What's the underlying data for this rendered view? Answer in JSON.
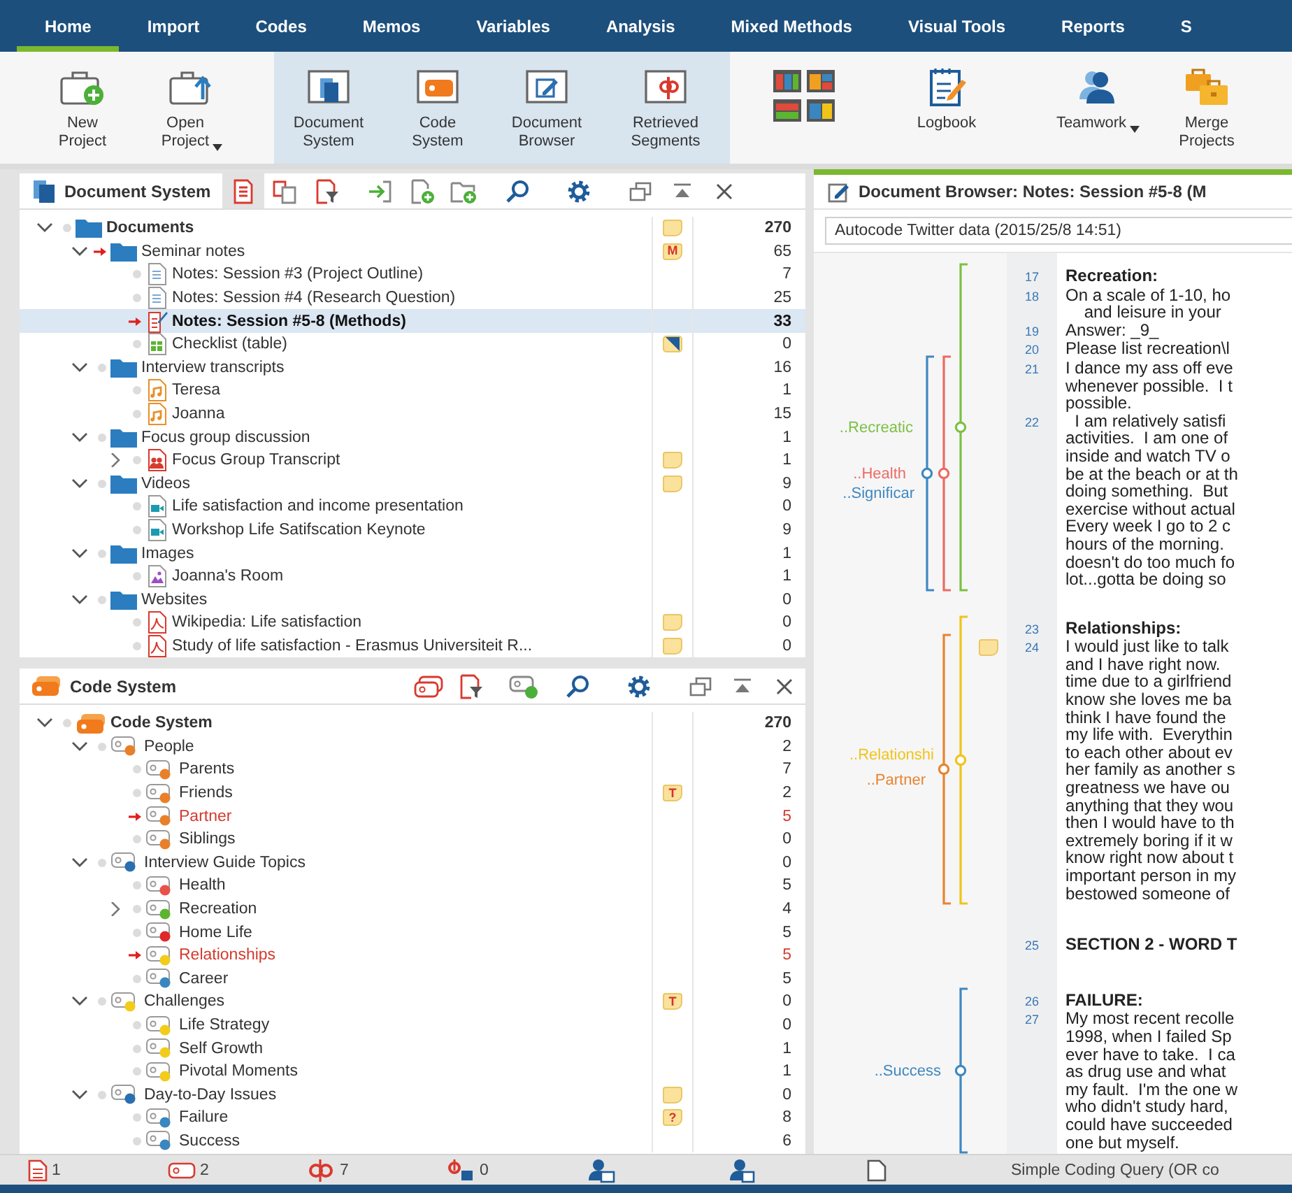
{
  "menu_tabs": [
    {
      "label": "Home",
      "selected": true
    },
    {
      "label": "Import",
      "selected": false
    },
    {
      "label": "Codes",
      "selected": false
    },
    {
      "label": "Memos",
      "selected": false
    },
    {
      "label": "Variables",
      "selected": false
    },
    {
      "label": "Analysis",
      "selected": false
    },
    {
      "label": "Mixed Methods",
      "selected": false
    },
    {
      "label": "Visual Tools",
      "selected": false
    },
    {
      "label": "Reports",
      "selected": false
    },
    {
      "label": "S",
      "selected": false
    }
  ],
  "ribbon": [
    {
      "kind": "new-project",
      "label": "New Project",
      "on": false
    },
    {
      "kind": "open-project",
      "label": "Open Project",
      "on": false,
      "dropdown": true
    },
    {
      "kind": "document-system",
      "label": "Document System",
      "on": true
    },
    {
      "kind": "code-system",
      "label": "Code System",
      "on": true
    },
    {
      "kind": "document-browser",
      "label": "Document Browser",
      "on": true
    },
    {
      "kind": "retrieved-segments",
      "label": "Retrieved Segments",
      "on": true
    },
    {
      "kind": "layouts",
      "on": false
    },
    {
      "kind": "logbook",
      "label": "Logbook",
      "on": false
    },
    {
      "kind": "teamwork",
      "label": "Teamwork",
      "on": false,
      "dropdown": true
    },
    {
      "kind": "merge-projects",
      "label": "Merge Projects",
      "on": false
    }
  ],
  "document_system": {
    "title": "Document System",
    "toolbar": [
      {
        "kind": "document-list",
        "on": true
      },
      {
        "kind": "document-pair",
        "on": false
      },
      {
        "kind": "document-filter",
        "on": false
      },
      {
        "kind": "import",
        "on": false
      },
      {
        "kind": "new-document",
        "on": false
      },
      {
        "kind": "new-folder",
        "on": false
      },
      {
        "kind": "search",
        "on": false
      },
      {
        "kind": "settings",
        "on": false
      },
      {
        "kind": "undock",
        "on": false
      },
      {
        "kind": "collapse",
        "on": false
      },
      {
        "kind": "close",
        "on": false
      }
    ],
    "items": [
      {
        "label": "Documents",
        "kind": "folder",
        "count": "270",
        "activated": false,
        "selected": false,
        "expanded": true,
        "memo": {
          "kind": "note"
        },
        "children": [
          {
            "label": "Seminar notes",
            "kind": "folder",
            "count": "65",
            "activated": true,
            "selected": false,
            "expanded": true,
            "memo": {
              "kind": "letter",
              "text": "M"
            },
            "children": [
              {
                "label": "Notes: Session #3 (Project Outline)",
                "kind": "text",
                "count": "7",
                "activated": false,
                "selected": false
              },
              {
                "label": "Notes: Session #4 (Research Question)",
                "kind": "text",
                "count": "25",
                "activated": false,
                "selected": false
              },
              {
                "label": "Notes: Session #5-8 (Methods)",
                "kind": "text-edit",
                "count": "33",
                "activated": true,
                "selected": true
              },
              {
                "label": "Checklist (table)",
                "kind": "table",
                "count": "0",
                "activated": false,
                "selected": false,
                "memo": {
                  "kind": "table"
                }
              }
            ]
          },
          {
            "label": "Interview transcripts",
            "kind": "folder",
            "count": "16",
            "activated": false,
            "selected": false,
            "expanded": true,
            "children": [
              {
                "label": "Teresa",
                "kind": "audio",
                "count": "1",
                "activated": false,
                "selected": false
              },
              {
                "label": "Joanna",
                "kind": "audio",
                "count": "15",
                "activated": false,
                "selected": false
              }
            ]
          },
          {
            "label": "Focus group discussion",
            "kind": "folder",
            "count": "1",
            "activated": false,
            "selected": false,
            "expanded": true,
            "children": [
              {
                "label": "Focus Group Transcript",
                "kind": "focus",
                "count": "1",
                "activated": false,
                "selected": false,
                "expanded": false,
                "memo": {
                  "kind": "note"
                }
              }
            ]
          },
          {
            "label": "Videos",
            "kind": "folder",
            "count": "9",
            "activated": false,
            "selected": false,
            "expanded": true,
            "memo": {
              "kind": "note"
            },
            "children": [
              {
                "label": "Life satisfaction and income presentation",
                "kind": "video",
                "count": "0",
                "activated": false,
                "selected": false
              },
              {
                "label": "Workshop Life Satifscation Keynote",
                "kind": "video",
                "count": "9",
                "activated": false,
                "selected": false
              }
            ]
          },
          {
            "label": "Images",
            "kind": "folder",
            "count": "1",
            "activated": false,
            "selected": false,
            "expanded": true,
            "children": [
              {
                "label": "Joanna's Room",
                "kind": "image",
                "count": "1",
                "activated": false,
                "selected": false
              }
            ]
          },
          {
            "label": "Websites",
            "kind": "folder",
            "count": "0",
            "activated": false,
            "selected": false,
            "expanded": true,
            "children": [
              {
                "label": "Wikipedia: Life satisfaction",
                "kind": "pdf",
                "count": "0",
                "activated": false,
                "selected": false,
                "memo": {
                  "kind": "note"
                }
              },
              {
                "label": "Study of life satisfaction - Erasmus Universiteit R...",
                "kind": "pdf",
                "count": "0",
                "activated": false,
                "selected": false,
                "memo": {
                  "kind": "note"
                }
              }
            ]
          }
        ]
      }
    ]
  },
  "code_system": {
    "title": "Code System",
    "toolbar": [
      {
        "kind": "code-list",
        "on": false
      },
      {
        "kind": "document-filter",
        "on": false
      },
      {
        "kind": "new-code",
        "on": false
      },
      {
        "kind": "search",
        "on": false
      },
      {
        "kind": "settings",
        "on": false
      },
      {
        "kind": "undock",
        "on": false
      },
      {
        "kind": "collapse",
        "on": false
      },
      {
        "kind": "close",
        "on": false
      }
    ],
    "items": [
      {
        "label": "Code System",
        "kind": "root",
        "count": "270",
        "activated": false,
        "selected": false,
        "expanded": true,
        "children": [
          {
            "label": "People",
            "kind": "code",
            "color": "#e8802a",
            "count": "2",
            "activated": false,
            "selected": false,
            "expanded": true,
            "children": [
              {
                "label": "Parents",
                "kind": "code",
                "color": "#e8802a",
                "count": "7",
                "activated": false,
                "selected": false
              },
              {
                "label": "Friends",
                "kind": "code",
                "color": "#e8802a",
                "count": "2",
                "activated": false,
                "selected": false,
                "memo": {
                  "kind": "letter",
                  "text": "T"
                }
              },
              {
                "label": "Partner",
                "kind": "code",
                "color": "#e8802a",
                "count": "5",
                "activated": true,
                "selected": false
              },
              {
                "label": "Siblings",
                "kind": "code",
                "color": "#e8802a",
                "count": "0",
                "activated": false,
                "selected": false
              }
            ]
          },
          {
            "label": "Interview Guide Topics",
            "kind": "code",
            "color": "#2a6fb0",
            "count": "0",
            "activated": false,
            "selected": false,
            "expanded": true,
            "children": [
              {
                "label": "Health",
                "kind": "code",
                "color": "#e8524a",
                "count": "5",
                "activated": false,
                "selected": false
              },
              {
                "label": "Recreation",
                "kind": "code",
                "color": "#5cb531",
                "count": "4",
                "activated": false,
                "selected": false,
                "expanded": false
              },
              {
                "label": "Home Life",
                "kind": "code",
                "color": "#e02828",
                "count": "5",
                "activated": false,
                "selected": false
              },
              {
                "label": "Relationships",
                "kind": "code",
                "color": "#f2cc1a",
                "count": "5",
                "activated": true,
                "selected": false
              },
              {
                "label": "Career",
                "kind": "code",
                "color": "#3a86c0",
                "count": "5",
                "activated": false,
                "selected": false
              }
            ]
          },
          {
            "label": "Challenges",
            "kind": "code",
            "color": "#f2cc1a",
            "count": "0",
            "activated": false,
            "selected": false,
            "expanded": true,
            "memo": {
              "kind": "letter",
              "text": "T"
            },
            "children": [
              {
                "label": "Life Strategy",
                "kind": "code",
                "color": "#f2cc1a",
                "count": "0",
                "activated": false,
                "selected": false
              },
              {
                "label": "Self Growth",
                "kind": "code",
                "color": "#f2cc1a",
                "count": "1",
                "activated": false,
                "selected": false
              },
              {
                "label": "Pivotal Moments",
                "kind": "code",
                "color": "#f2cc1a",
                "count": "1",
                "activated": false,
                "selected": false
              }
            ]
          },
          {
            "label": "Day-to-Day Issues",
            "kind": "code",
            "color": "#2a6fb0",
            "count": "0",
            "activated": false,
            "selected": false,
            "expanded": true,
            "memo": {
              "kind": "note"
            },
            "children": [
              {
                "label": "Failure",
                "kind": "code",
                "color": "#3a86c0",
                "count": "8",
                "activated": false,
                "selected": false,
                "memo": {
                  "kind": "letter",
                  "text": "?"
                }
              },
              {
                "label": "Success",
                "kind": "code",
                "color": "#3a86c0",
                "count": "6",
                "activated": false,
                "selected": false
              }
            ]
          }
        ]
      }
    ]
  },
  "document_browser": {
    "title": "Document Browser: Notes: Session #5-8 (M",
    "segment_field": {
      "value": "Autocode Twitter data (2015/25/8 14:51)"
    },
    "codings": [
      {
        "label": "..Recreatic",
        "color": "#7cc142"
      },
      {
        "label": "..Health",
        "color": "#ec6b63"
      },
      {
        "label": "..Significar",
        "color": "#3f88c0"
      },
      {
        "label": "..Relationshi",
        "color": "#f0c419"
      },
      {
        "label": "..Partner",
        "color": "#e8842e"
      },
      {
        "label": "..Success",
        "color": "#3f88c0"
      }
    ],
    "paragraphs": [
      {
        "number": "17",
        "kind": "heading",
        "lines": [
          "Recreation:"
        ]
      },
      {
        "number": "18",
        "kind": "text",
        "lines": [
          "On a scale of 1-10, ho",
          "    and leisure in your"
        ]
      },
      {
        "number": "19",
        "kind": "text",
        "lines": [
          "Answer: _9_"
        ]
      },
      {
        "number": "20",
        "kind": "text",
        "lines": [
          "Please list recreation\\l"
        ]
      },
      {
        "number": "21",
        "kind": "text",
        "lines": [
          "I dance my ass off eve",
          "whenever possible.  I t",
          "possible."
        ]
      },
      {
        "number": "22",
        "kind": "text",
        "lines": [
          "  I am relatively satisfi",
          "activities.  I am one of",
          "inside and watch TV o",
          "be at the beach or at th",
          "doing something.  But",
          "exercise without actual",
          "Every week I go to 2 c",
          "hours of the morning.",
          "doesn't do too much fo",
          "lot...gotta be doing so"
        ]
      },
      {
        "number": "23",
        "kind": "heading",
        "lines": [
          "Relationships:"
        ]
      },
      {
        "number": "24",
        "kind": "text",
        "memo": {
          "kind": "note"
        },
        "lines": [
          "I would just like to talk",
          "and I have right now.",
          "time due to a girlfriend",
          "know she loves me ba",
          "think I have found the",
          "my life with.  Everythin",
          "to each other about ev",
          "her family as another s",
          "greatness we have ou",
          "anything that they wou",
          "then I would have to th",
          "extremely boring if it w",
          "know right now about t",
          "important person in my",
          "bestowed someone of"
        ]
      },
      {
        "number": "25",
        "kind": "section",
        "lines": [
          "SECTION 2 - WORD T"
        ]
      },
      {
        "number": "26",
        "kind": "label",
        "lines": [
          "FAILURE:"
        ]
      },
      {
        "number": "27",
        "kind": "text",
        "lines": [
          "My most recent recolle",
          "1998, when I failed Sp",
          "ever have to take.  I ca",
          "as drug use and what",
          "my fault.  I'm the one w",
          "who didn't study hard,",
          "could have succeeded",
          "one but myself."
        ]
      }
    ]
  },
  "status_bar": [
    {
      "kind": "documents",
      "count": "1"
    },
    {
      "kind": "codes",
      "count": "2"
    },
    {
      "kind": "segments",
      "count": "7"
    },
    {
      "kind": "weights",
      "count": "0"
    },
    {
      "kind": "user"
    },
    {
      "kind": "users"
    },
    {
      "kind": "blank-document"
    },
    {
      "kind": "query",
      "text": "Simple Coding Query (OR co"
    }
  ]
}
